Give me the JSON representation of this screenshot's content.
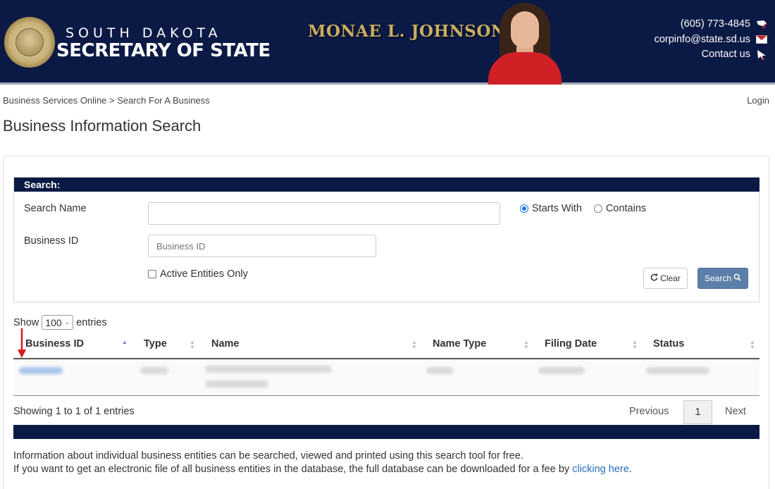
{
  "header": {
    "state_line": "SOUTH DAKOTA",
    "office_line": "SECRETARY OF STATE",
    "official_name": "MONAE L. JOHNSON",
    "phone": "(605) 773-4845",
    "email": "corpinfo@state.sd.us",
    "contact": "Contact us",
    "colors": {
      "navy": "#0b1a45",
      "gold": "#c9ad66"
    }
  },
  "breadcrumb": "Business Services Online > Search For A Business",
  "login": "Login",
  "page_title": "Business Information Search",
  "search": {
    "heading": "Search:",
    "name_label": "Search Name",
    "name_value": "",
    "id_label": "Business ID",
    "id_placeholder": "Business ID",
    "radio_starts": "Starts With",
    "radio_contains": "Contains",
    "selected_mode": "Starts With",
    "active_only_label": "Active Entities Only",
    "clear_label": "Clear",
    "search_label": "Search"
  },
  "table": {
    "show_label": "Show",
    "entries_label": "entries",
    "page_size": "100",
    "columns": [
      "Business ID",
      "Type",
      "Name",
      "Name Type",
      "Filing Date",
      "Status"
    ],
    "sorted_column": "Business ID",
    "info": "Showing 1 to 1 of 1 entries",
    "prev": "Previous",
    "current_page": "1",
    "next": "Next"
  },
  "footer": {
    "line1": "Information about individual business entities can be searched, viewed and printed using this search tool for free.",
    "line2_prefix": "If you want to get an electronic file of all business entities in the database, the full database can be downloaded for a fee by ",
    "line2_link": "clicking here",
    "line2_suffix": "."
  }
}
